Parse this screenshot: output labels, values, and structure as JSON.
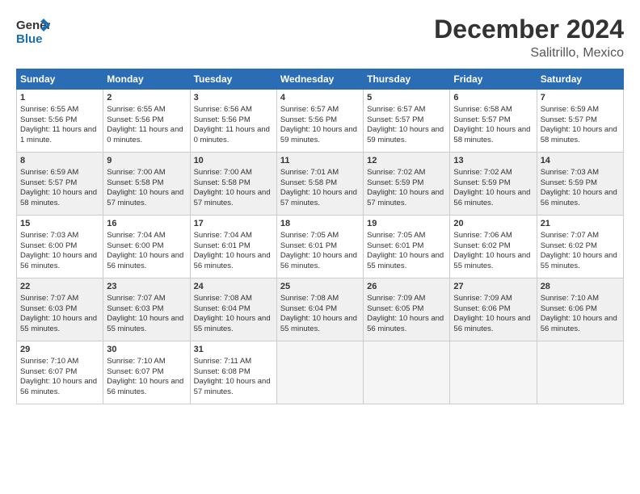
{
  "header": {
    "logo_general": "General",
    "logo_blue": "Blue",
    "title": "December 2024",
    "subtitle": "Salitrillo, Mexico"
  },
  "days_of_week": [
    "Sunday",
    "Monday",
    "Tuesday",
    "Wednesday",
    "Thursday",
    "Friday",
    "Saturday"
  ],
  "weeks": [
    [
      {
        "day": "1",
        "info": "Sunrise: 6:55 AM\nSunset: 5:56 PM\nDaylight: 11 hours and 1 minute."
      },
      {
        "day": "2",
        "info": "Sunrise: 6:55 AM\nSunset: 5:56 PM\nDaylight: 11 hours and 0 minutes."
      },
      {
        "day": "3",
        "info": "Sunrise: 6:56 AM\nSunset: 5:56 PM\nDaylight: 11 hours and 0 minutes."
      },
      {
        "day": "4",
        "info": "Sunrise: 6:57 AM\nSunset: 5:56 PM\nDaylight: 10 hours and 59 minutes."
      },
      {
        "day": "5",
        "info": "Sunrise: 6:57 AM\nSunset: 5:57 PM\nDaylight: 10 hours and 59 minutes."
      },
      {
        "day": "6",
        "info": "Sunrise: 6:58 AM\nSunset: 5:57 PM\nDaylight: 10 hours and 58 minutes."
      },
      {
        "day": "7",
        "info": "Sunrise: 6:59 AM\nSunset: 5:57 PM\nDaylight: 10 hours and 58 minutes."
      }
    ],
    [
      {
        "day": "8",
        "info": "Sunrise: 6:59 AM\nSunset: 5:57 PM\nDaylight: 10 hours and 58 minutes."
      },
      {
        "day": "9",
        "info": "Sunrise: 7:00 AM\nSunset: 5:58 PM\nDaylight: 10 hours and 57 minutes."
      },
      {
        "day": "10",
        "info": "Sunrise: 7:00 AM\nSunset: 5:58 PM\nDaylight: 10 hours and 57 minutes."
      },
      {
        "day": "11",
        "info": "Sunrise: 7:01 AM\nSunset: 5:58 PM\nDaylight: 10 hours and 57 minutes."
      },
      {
        "day": "12",
        "info": "Sunrise: 7:02 AM\nSunset: 5:59 PM\nDaylight: 10 hours and 57 minutes."
      },
      {
        "day": "13",
        "info": "Sunrise: 7:02 AM\nSunset: 5:59 PM\nDaylight: 10 hours and 56 minutes."
      },
      {
        "day": "14",
        "info": "Sunrise: 7:03 AM\nSunset: 5:59 PM\nDaylight: 10 hours and 56 minutes."
      }
    ],
    [
      {
        "day": "15",
        "info": "Sunrise: 7:03 AM\nSunset: 6:00 PM\nDaylight: 10 hours and 56 minutes."
      },
      {
        "day": "16",
        "info": "Sunrise: 7:04 AM\nSunset: 6:00 PM\nDaylight: 10 hours and 56 minutes."
      },
      {
        "day": "17",
        "info": "Sunrise: 7:04 AM\nSunset: 6:01 PM\nDaylight: 10 hours and 56 minutes."
      },
      {
        "day": "18",
        "info": "Sunrise: 7:05 AM\nSunset: 6:01 PM\nDaylight: 10 hours and 56 minutes."
      },
      {
        "day": "19",
        "info": "Sunrise: 7:05 AM\nSunset: 6:01 PM\nDaylight: 10 hours and 55 minutes."
      },
      {
        "day": "20",
        "info": "Sunrise: 7:06 AM\nSunset: 6:02 PM\nDaylight: 10 hours and 55 minutes."
      },
      {
        "day": "21",
        "info": "Sunrise: 7:07 AM\nSunset: 6:02 PM\nDaylight: 10 hours and 55 minutes."
      }
    ],
    [
      {
        "day": "22",
        "info": "Sunrise: 7:07 AM\nSunset: 6:03 PM\nDaylight: 10 hours and 55 minutes."
      },
      {
        "day": "23",
        "info": "Sunrise: 7:07 AM\nSunset: 6:03 PM\nDaylight: 10 hours and 55 minutes."
      },
      {
        "day": "24",
        "info": "Sunrise: 7:08 AM\nSunset: 6:04 PM\nDaylight: 10 hours and 55 minutes."
      },
      {
        "day": "25",
        "info": "Sunrise: 7:08 AM\nSunset: 6:04 PM\nDaylight: 10 hours and 55 minutes."
      },
      {
        "day": "26",
        "info": "Sunrise: 7:09 AM\nSunset: 6:05 PM\nDaylight: 10 hours and 56 minutes."
      },
      {
        "day": "27",
        "info": "Sunrise: 7:09 AM\nSunset: 6:06 PM\nDaylight: 10 hours and 56 minutes."
      },
      {
        "day": "28",
        "info": "Sunrise: 7:10 AM\nSunset: 6:06 PM\nDaylight: 10 hours and 56 minutes."
      }
    ],
    [
      {
        "day": "29",
        "info": "Sunrise: 7:10 AM\nSunset: 6:07 PM\nDaylight: 10 hours and 56 minutes."
      },
      {
        "day": "30",
        "info": "Sunrise: 7:10 AM\nSunset: 6:07 PM\nDaylight: 10 hours and 56 minutes."
      },
      {
        "day": "31",
        "info": "Sunrise: 7:11 AM\nSunset: 6:08 PM\nDaylight: 10 hours and 57 minutes."
      },
      null,
      null,
      null,
      null
    ]
  ]
}
